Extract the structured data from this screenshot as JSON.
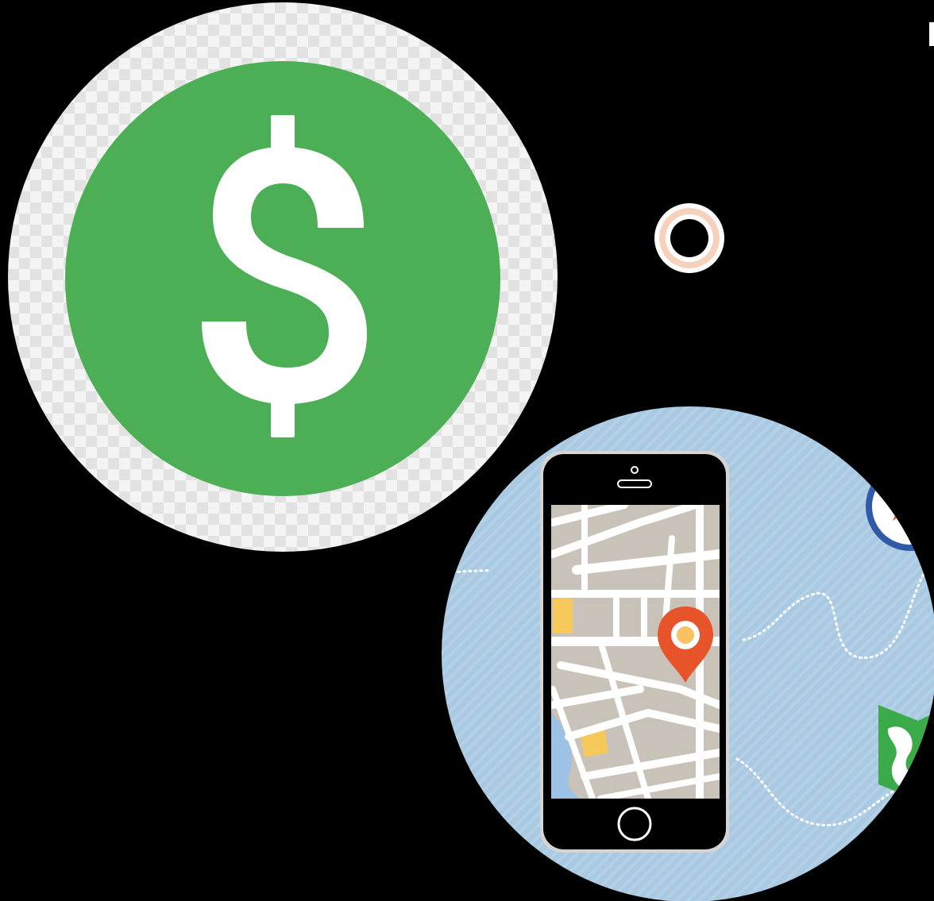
{
  "colors": {
    "background": "#000000",
    "dollar_green": "#4caf55",
    "dollar_symbol": "#ffffff",
    "checker_light": "#f4f4f4",
    "checker_dark": "#e2e2e2",
    "ring_peach": "#f6d2bd",
    "map_water": "#a9c9e2",
    "phone_body": "#000000",
    "phone_frame": "#c8c8c8",
    "map_block": "#c9c2b8",
    "map_road": "#ffffff",
    "map_yellow": "#f5c95a",
    "map_river": "#9ec2e6",
    "pin_orange": "#e8542a",
    "pin_center": "#f8c162",
    "map_icon_green": "#3bab4a",
    "compass_blue": "#2f5aa8"
  },
  "icons": {
    "dollar": "dollar-sign-icon",
    "ring": "ring-icon",
    "phone": "smartphone-icon",
    "pin": "map-pin-icon",
    "folded_map": "folded-map-icon",
    "compass": "compass-icon"
  }
}
